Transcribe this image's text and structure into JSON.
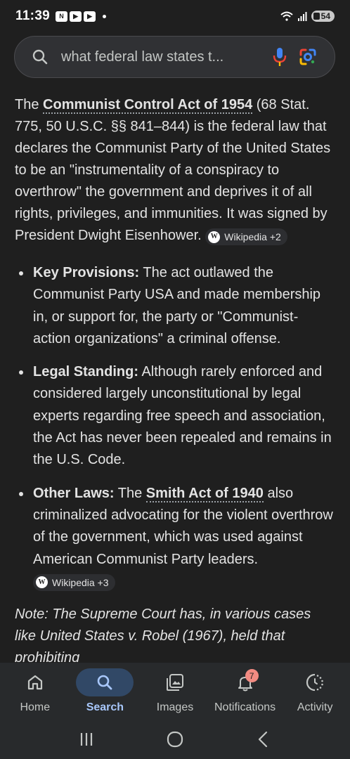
{
  "status_bar": {
    "time": "11:39",
    "app_icons": [
      "N",
      "▶",
      "▶"
    ],
    "battery": "54"
  },
  "search": {
    "query": "what federal law states t..."
  },
  "answer": {
    "intro_prefix": "The ",
    "intro_link": "Communist Control Act of 1954",
    "intro_text": " (68 Stat. 775, 50 U.S.C. §§ 841–844) is the federal law that declares the Communist Party of the United States to be an \"instrumentality of a conspiracy to overthrow\" the government and deprives it of all rights, privileges, and immunities. It was signed by President Dwight Eisenhower. ",
    "intro_chip": "Wikipedia +2",
    "bullets": [
      {
        "title": "Key Provisions:",
        "text": " The act outlawed the Communist Party USA and made membership in, or support for, the party or \"Communist-action organizations\" a criminal offense."
      },
      {
        "title": "Legal Standing:",
        "text": " Although rarely enforced and considered largely unconstitutional by legal experts regarding free speech and association, the Act has never been repealed and remains in the U.S. Code."
      },
      {
        "title": "Other Laws:",
        "text_before": " The ",
        "link": "Smith Act of 1940",
        "text": " also criminalized advocating for the violent overthrow of the government, which was used against American Communist Party leaders. ",
        "chip": "Wikipedia +3"
      }
    ],
    "note": "Note: The Supreme Court has, in various cases like United States v. Robel (1967), held that prohibiting"
  },
  "bottom_nav": {
    "items": [
      {
        "label": "Home",
        "icon": "home-icon"
      },
      {
        "label": "Search",
        "icon": "search-icon",
        "active": true
      },
      {
        "label": "Images",
        "icon": "images-icon"
      },
      {
        "label": "Notifications",
        "icon": "bell-icon",
        "badge": "7"
      },
      {
        "label": "Activity",
        "icon": "activity-icon"
      }
    ]
  },
  "colors": {
    "background": "#1f1f1f",
    "active_nav_bg": "#314866",
    "active_nav_text": "#a8c7fa",
    "badge": "#f28b82"
  }
}
